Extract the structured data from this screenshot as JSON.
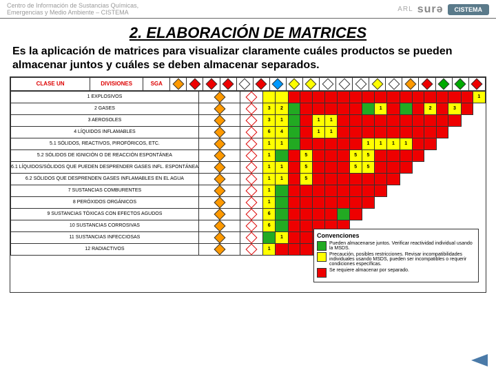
{
  "header": {
    "org_line1": "Centro de Información de Sustancias Químicas,",
    "org_line2": "Emergencias y Medio Ambiente – CISTEMA",
    "arl": "ARL",
    "brand": "surə",
    "badge": "CISTEMA"
  },
  "title": "2. ELABORACIÓN DE MATRICES",
  "description": "Es la aplicación de matrices para visualizar claramente cuáles productos se pueden almacenar juntos y cuáles se deben almacenar separados.",
  "cols": {
    "c1": "CLASE UN",
    "c2": "DIVISIONES",
    "c3": "SGA"
  },
  "rows": [
    {
      "label": "1 EXPLOSIVOS",
      "vals": [
        "",
        "",
        "",
        "",
        "",
        "",
        "",
        "",
        "",
        "",
        "",
        "",
        "",
        "",
        "",
        "",
        "",
        "1"
      ]
    },
    {
      "label": "2 GASES",
      "vals": [
        "3",
        "2",
        "",
        "",
        "",
        "",
        "",
        "",
        "",
        "1",
        "",
        "",
        "",
        "2",
        "",
        "3",
        ""
      ]
    },
    {
      "label": "3 AEROSOLES",
      "vals": [
        "3",
        "1",
        "",
        "",
        "1",
        "1",
        "",
        "",
        "",
        "",
        "",
        "",
        "",
        "",
        "",
        ""
      ]
    },
    {
      "label": "4 LÍQUIDOS INFLAMABLES",
      "vals": [
        "6",
        "4",
        "",
        "",
        "1",
        "1",
        "",
        "",
        "",
        "",
        "",
        "",
        "",
        "",
        ""
      ]
    },
    {
      "label": "5.1 SÓLIDOS, REACTIVOS, PIROFÓRICOS, ETC.",
      "vals": [
        "1",
        "1",
        "",
        "",
        "",
        "",
        "",
        "",
        "1",
        "1",
        "1",
        "1",
        "",
        ""
      ]
    },
    {
      "label": "5.2 SÓLIDOS DE IGNICIÓN O DE REACCIÓN ESPONTÁNEA",
      "vals": [
        "1",
        "",
        "",
        "5",
        "",
        "",
        "",
        "5",
        "5",
        "",
        "",
        "",
        ""
      ]
    },
    {
      "label": "6.1 LÍQUIDOS/SÓLIDOS QUE PUEDEN DESPRENDER GASES INFL. ESPONTÁNEA",
      "vals": [
        "1",
        "1",
        "",
        "5",
        "",
        "",
        "",
        "5",
        "5",
        "",
        "",
        ""
      ]
    },
    {
      "label": "6.2 SÓLIDOS QUE DESPRENDEN GASES INFLAMABLES EN EL AGUA",
      "vals": [
        "1",
        "1",
        "",
        "5",
        "",
        "",
        "",
        "",
        "",
        "",
        ""
      ]
    },
    {
      "label": "7 SUSTANCIAS COMBURENTES",
      "vals": [
        "1",
        "",
        "",
        "",
        "",
        "",
        "",
        "",
        "",
        ""
      ]
    },
    {
      "label": "8 PERÓXIDOS ORGÁNICOS",
      "vals": [
        "1",
        "",
        "",
        "",
        "",
        "",
        "",
        "",
        ""
      ]
    },
    {
      "label": "9 SUSTANCIAS TÓXICAS CON EFECTOS AGUDOS",
      "vals": [
        "6",
        "",
        "",
        "",
        "",
        "",
        "",
        ""
      ]
    },
    {
      "label": "10 SUSTANCIAS CORROSIVAS",
      "vals": [
        "6",
        "",
        "",
        "",
        "",
        "",
        ""
      ]
    },
    {
      "label": "11 SUSTANCIAS INFECCIOSAS",
      "vals": [
        "",
        "1",
        "",
        "",
        "",
        ""
      ]
    },
    {
      "label": "12 RADIACTIVOS",
      "vals": [
        "1",
        "",
        "",
        "",
        ""
      ]
    }
  ],
  "colors": [
    [
      "y",
      "y",
      "r",
      "r",
      "r",
      "r",
      "r",
      "r",
      "r",
      "r",
      "r",
      "r",
      "r",
      "r",
      "r",
      "r",
      "r",
      "y"
    ],
    [
      "y",
      "y",
      "g",
      "r",
      "r",
      "r",
      "r",
      "r",
      "g",
      "y",
      "r",
      "g",
      "r",
      "y",
      "r",
      "y",
      "r"
    ],
    [
      "y",
      "y",
      "g",
      "r",
      "y",
      "y",
      "r",
      "r",
      "r",
      "r",
      "r",
      "r",
      "r",
      "r",
      "r",
      "r"
    ],
    [
      "y",
      "y",
      "g",
      "r",
      "y",
      "y",
      "r",
      "r",
      "r",
      "r",
      "r",
      "r",
      "r",
      "r",
      "r"
    ],
    [
      "y",
      "y",
      "g",
      "r",
      "r",
      "r",
      "r",
      "r",
      "y",
      "y",
      "y",
      "y",
      "r",
      "r"
    ],
    [
      "y",
      "g",
      "r",
      "y",
      "r",
      "r",
      "r",
      "y",
      "y",
      "r",
      "r",
      "r",
      "r"
    ],
    [
      "y",
      "y",
      "r",
      "y",
      "r",
      "r",
      "r",
      "y",
      "y",
      "r",
      "r",
      "r"
    ],
    [
      "y",
      "y",
      "r",
      "y",
      "r",
      "r",
      "r",
      "r",
      "r",
      "r",
      "r"
    ],
    [
      "y",
      "g",
      "r",
      "r",
      "r",
      "r",
      "r",
      "r",
      "r",
      "r"
    ],
    [
      "y",
      "g",
      "r",
      "r",
      "r",
      "r",
      "r",
      "r",
      "r"
    ],
    [
      "y",
      "g",
      "r",
      "r",
      "r",
      "r",
      "g",
      "r"
    ],
    [
      "y",
      "g",
      "r",
      "r",
      "r",
      "r",
      "r"
    ],
    [
      "g",
      "y",
      "r",
      "r",
      "r",
      "r"
    ],
    [
      "y",
      "r",
      "r",
      "r",
      "r"
    ]
  ],
  "legend": {
    "title": "Convenciones",
    "green": "Pueden almacenarse juntos. Verificar reactividad individual usando la MSDS.",
    "yellow": "Precaución, posibles restricciones. Revisar incompatibilidades individuales usando MSDS, pueden ser incompatibles o requerir condiciones específicas.",
    "red": "Se requiere almacenar por separado."
  }
}
